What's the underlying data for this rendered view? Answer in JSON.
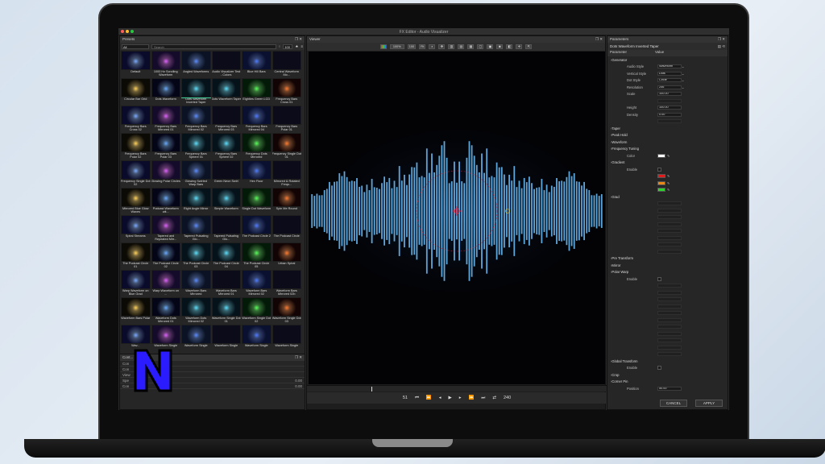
{
  "window": {
    "title": "FX Editor - Audio Visualizer"
  },
  "presets": {
    "title": "Presets",
    "filter": "All",
    "search_placeholder": "Search",
    "count": "100",
    "items": [
      "Default",
      "1000 Hz Scrolling Waveform",
      "Angled Waveforms",
      "Audio Visualizer Test - Colors",
      "Blue Hill Bars",
      "Central Waveform Mo...",
      "Circular Bar Grid",
      "Dots Waveform",
      "Dots Waveform Inverted Taper",
      "Dots Waveform Taper",
      "Eighties Green LCD",
      "Frequency Bars Cross 01",
      "Frequency Bars Cross 02",
      "Frequency Bars Mirrored 01",
      "Frequency Bars Mirrored 02",
      "Frequency Bars Mirrored 03",
      "Frequency Bars Mirrored 04",
      "Frequency Bars Polar 01",
      "Frequency Bars Polar 02",
      "Frequency Bars Polar 03",
      "Frequency Bars Sphere 01",
      "Frequency Bars Sphere 02",
      "Frequency Dots Mirrored",
      "Frequency Single Dot 01",
      "Frequency Single Dot 02",
      "Glowing Polar Circles",
      "Glowing Swirled Warp Bars",
      "Green Neon Swirl",
      "Hex Floor",
      "Mirrored & Rotated Frequ...",
      "Mirrored Blue Glow Waves",
      "Podcast Waveform wit...",
      "Right Angle Mirror",
      "Simple Waveform",
      "Single Dot Waveform",
      "Spin Me Round",
      "Spiral Streams",
      "Tapered and Repeated Mirr...",
      "Tapered Pulsating Glo...",
      "Tapered Pulsating Glo...",
      "The Podcast Circle 2",
      "The Podcast Circle",
      "The Podcast Circle 01",
      "The Podcast Circle 02",
      "The Podcast Circle 03",
      "The Podcast Circle 04",
      "The Podcast Circle 05",
      "Urban Spiral",
      "Warp Waveform on Blue Grad",
      "Warp Waveform on ...",
      "Waveform Bars Mirrored",
      "Waveform Bars Mirrored 01",
      "Waveform Bars Mirrored 02",
      "Waveform Bars Mirrored 02b",
      "Waveform Bars Polar",
      "Waveform Dots Mirrored 01",
      "Waveform Dots Mirrored 02",
      "Waveform Single Dot 01",
      "Waveform Single Dot 02",
      "Waveform Single Dot 03",
      "Wav...",
      "Waveform Single",
      "Waveform Single",
      "Waveform Single",
      "Waveform Single",
      "Waveform Single"
    ]
  },
  "controls": {
    "title": "Cont...",
    "rows": [
      {
        "label": "Con",
        "value": ""
      },
      {
        "label": "Con",
        "value": ""
      },
      {
        "label": "View",
        "value": ""
      },
      {
        "label": "Spe",
        "value": "0.00"
      },
      {
        "label": "Con",
        "value": "0.00"
      }
    ]
  },
  "viewer": {
    "title": "Viewer",
    "zoom": "100%",
    "fit": "100",
    "fit2": "Fit",
    "current_frame": "51",
    "end_frame": "240"
  },
  "parameters": {
    "title": "Parameters",
    "preset_name": "Dots Waveform Inverted Taper",
    "col_param": "Parameter",
    "col_value": "Value",
    "rows": [
      {
        "label": "Generator",
        "value": "",
        "type": "group"
      },
      {
        "label": "Audio Style",
        "value": "Waveform",
        "type": "select"
      },
      {
        "label": "Vertical Style",
        "value": "Dots",
        "type": "select"
      },
      {
        "label": "Dot Style",
        "value": "Circle",
        "type": "select"
      },
      {
        "label": "Resolution",
        "value": "256",
        "type": "select"
      },
      {
        "label": "Scale",
        "value": "100.00",
        "type": "num"
      },
      {
        "label": "",
        "value": "",
        "type": "num"
      },
      {
        "label": "Height",
        "value": "100.00",
        "type": "num"
      },
      {
        "label": "Density",
        "value": "0.00",
        "type": "num"
      },
      {
        "label": "",
        "value": "",
        "type": "num"
      },
      {
        "label": "Taper",
        "value": "",
        "type": "group"
      },
      {
        "label": "Peak Hold",
        "value": "",
        "type": "group"
      },
      {
        "label": "Waveform",
        "value": "",
        "type": "group"
      },
      {
        "label": "Frequency Tuning",
        "value": "",
        "type": "group"
      },
      {
        "label": "Color",
        "value": "",
        "type": "color"
      },
      {
        "label": "Gradient",
        "value": "",
        "type": "group"
      },
      {
        "label": "Enable",
        "value": "",
        "type": "check"
      },
      {
        "label": "",
        "value": "",
        "type": "swred"
      },
      {
        "label": "",
        "value": "",
        "type": "sworange"
      },
      {
        "label": "",
        "value": "",
        "type": "swgreen"
      },
      {
        "label": "Grad",
        "value": "",
        "type": "group"
      },
      {
        "label": "",
        "value": "",
        "type": "num"
      },
      {
        "label": "",
        "value": "",
        "type": "num"
      },
      {
        "label": "",
        "value": "",
        "type": "num"
      },
      {
        "label": "",
        "value": "",
        "type": "num"
      },
      {
        "label": "",
        "value": "",
        "type": "num"
      },
      {
        "label": "",
        "value": "",
        "type": "num"
      },
      {
        "label": "",
        "value": "",
        "type": "num"
      },
      {
        "label": "",
        "value": "",
        "type": "num"
      },
      {
        "label": "Pre Transform",
        "value": "",
        "type": "group"
      },
      {
        "label": "Mirror",
        "value": "",
        "type": "group"
      },
      {
        "label": "Polar Warp",
        "value": "",
        "type": "group"
      },
      {
        "label": "Enable",
        "value": "",
        "type": "check"
      },
      {
        "label": "",
        "value": "",
        "type": "num"
      },
      {
        "label": "",
        "value": "",
        "type": "num"
      },
      {
        "label": "",
        "value": "",
        "type": "num"
      },
      {
        "label": "",
        "value": "",
        "type": "num"
      },
      {
        "label": "",
        "value": "",
        "type": "num"
      },
      {
        "label": "",
        "value": "",
        "type": "num"
      },
      {
        "label": "",
        "value": "",
        "type": "num"
      },
      {
        "label": "",
        "value": "",
        "type": "num"
      },
      {
        "label": "",
        "value": "",
        "type": "num"
      },
      {
        "label": "",
        "value": "",
        "type": "num"
      },
      {
        "label": "",
        "value": "",
        "type": "num"
      },
      {
        "label": "Global Transform",
        "value": "",
        "type": "group"
      },
      {
        "label": "Enable",
        "value": "",
        "type": "check"
      },
      {
        "label": "Crop",
        "value": "",
        "type": "group"
      },
      {
        "label": "Corner Pin",
        "value": "",
        "type": "group"
      },
      {
        "label": "Position",
        "value": "50.00",
        "type": "num"
      },
      {
        "label": "Position Z",
        "value": "0.00",
        "type": "num"
      },
      {
        "label": "Rotation",
        "value": "",
        "type": "num"
      }
    ],
    "cancel": "CANCEL",
    "apply": "APPLY"
  },
  "colors": {
    "accent": "#2a7fff",
    "bars": "#6fc3ff",
    "red": "#e21b1b",
    "orange": "#e7891a",
    "green": "#2ed12e"
  }
}
